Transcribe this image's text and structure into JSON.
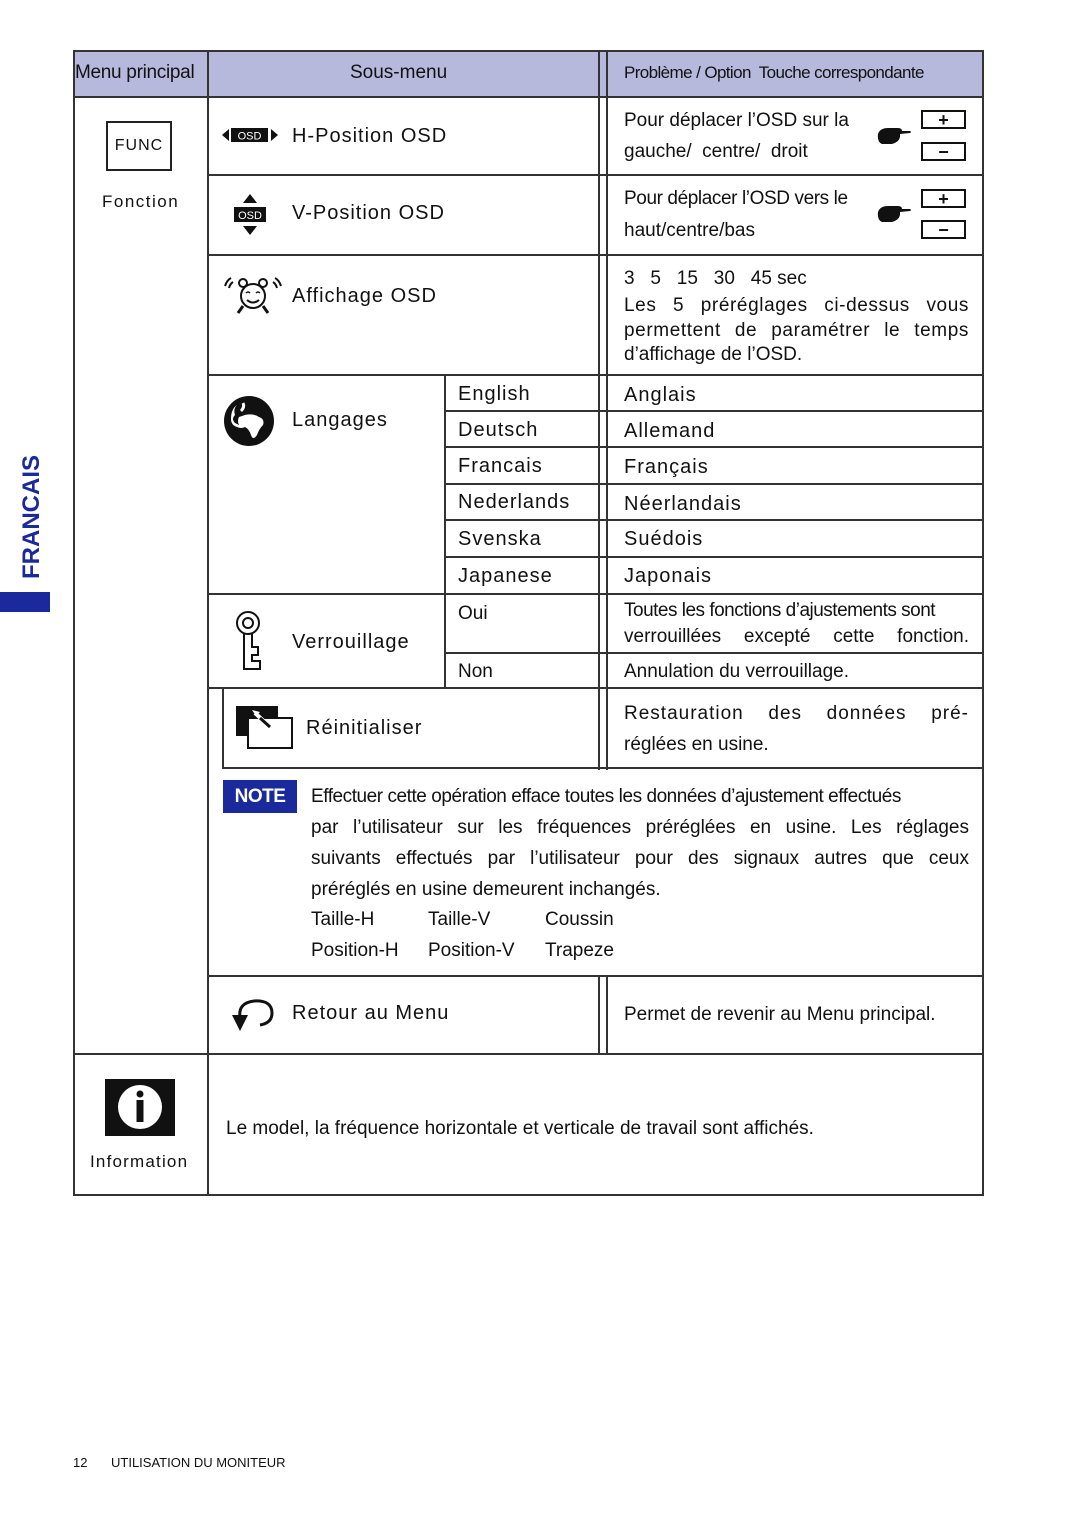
{
  "side_label": "FRANCAIS",
  "accent_color": "#1a2a9c",
  "header": {
    "col1": "Menu principal",
    "col2": "Sous-menu",
    "col3": "Problème / Option  Touche correspondante",
    "bg_color": "#b6b9dc"
  },
  "function_menu": {
    "icon_label": "FUNC",
    "caption": "Fonction"
  },
  "rows": {
    "h_position": {
      "icon": "osd-left-right-icon",
      "label": "H-Position OSD",
      "desc_line1": "Pour déplacer l’OSD sur la",
      "desc_line2": "gauche/  centre/  droit",
      "keys": [
        "+",
        "−"
      ]
    },
    "v_position": {
      "icon": "osd-up-down-icon",
      "label": "V-Position OSD",
      "desc_line1": "Pour déplacer l’OSD vers le",
      "desc_line2": "haut/centre/bas",
      "keys": [
        "+",
        "−"
      ]
    },
    "affichage": {
      "icon": "alarm-clock-icon",
      "label": "Affichage OSD",
      "values": "3   5   15   30   45 sec",
      "desc_lines": [
        "Les 5 préréglages ci-dessus vous",
        "permettent de paramétrer le temps"
      ],
      "desc_last": "d’affichage de l’OSD."
    },
    "langages": {
      "icon": "globe-icon",
      "label": "Langages",
      "options": [
        {
          "option": "English",
          "meaning": "Anglais"
        },
        {
          "option": "Deutsch",
          "meaning": "Allemand"
        },
        {
          "option": "Francais",
          "meaning": "Français"
        },
        {
          "option": "Nederlands",
          "meaning": "Néerlandais"
        },
        {
          "option": "Svenska",
          "meaning": "Suédois"
        },
        {
          "option": "Japanese",
          "meaning": "Japonais"
        }
      ]
    },
    "verrouillage": {
      "icon": "key-icon",
      "label": "Verrouillage",
      "oui": "Oui",
      "oui_desc_line1": "Toutes les fonctions d’ajustements sont",
      "oui_desc_line2": "verrouillées excepté cette fonction.",
      "non": "Non",
      "non_desc": "Annulation du verrouillage."
    },
    "reinitialiser": {
      "icon": "reset-icon",
      "label": "Réinitialiser",
      "desc_line1": "Restauration des données pré-",
      "desc_line2": "réglées en usine."
    },
    "note": {
      "badge": "NOTE",
      "lines": [
        "Effectuer cette opération efface toutes les données d’ajustement effectués",
        "par l’utilisateur sur les fréquences préréglées en usine. Les réglages",
        "suivants effectués par l’utilisateur pour des signaux autres que ceux"
      ],
      "last_line": "préréglés en usine demeurent inchangés.",
      "settings": [
        [
          "Taille-H",
          "Taille-V",
          "Coussin"
        ],
        [
          "Position-H",
          "Position-V",
          "Trapeze"
        ]
      ]
    },
    "retour": {
      "icon": "return-arrow-icon",
      "label": "Retour au Menu",
      "desc": "Permet de revenir au Menu principal."
    }
  },
  "information": {
    "icon": "info-icon",
    "caption": "Information",
    "desc": "Le model, la fréquence horizontale et verticale de travail sont affichés."
  },
  "footer": {
    "page_number": "12",
    "section": "UTILISATION DU MONITEUR"
  }
}
